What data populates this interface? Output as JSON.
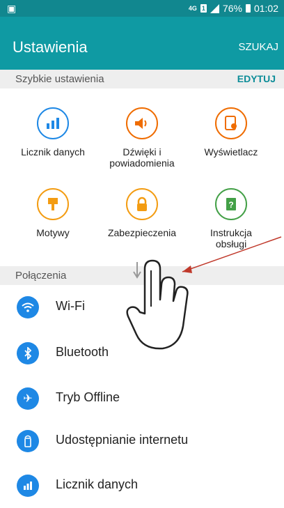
{
  "status_bar": {
    "network": "4G",
    "sim": "1",
    "battery": "76%",
    "time": "01:02"
  },
  "app_bar": {
    "title": "Ustawienia",
    "search_label": "SZUKAJ"
  },
  "quick_settings": {
    "header": "Szybkie ustawienia",
    "edit_label": "EDYTUJ",
    "items": [
      {
        "label": "Licznik danych",
        "icon": "data-usage-icon",
        "color": "#1e88e5"
      },
      {
        "label": "Dźwięki i powiadomienia",
        "icon": "volume-icon",
        "color": "#ef6c00"
      },
      {
        "label": "Wyświetlacz",
        "icon": "display-icon",
        "color": "#ef6c00"
      },
      {
        "label": "Motywy",
        "icon": "themes-brush-icon",
        "color": "#f39c12"
      },
      {
        "label": "Zabezpieczenia",
        "icon": "lock-icon",
        "color": "#f39c12"
      },
      {
        "label": "Instrukcja obsługi",
        "icon": "help-book-icon",
        "color": "#43a047"
      }
    ]
  },
  "connections": {
    "header": "Połączenia",
    "items": [
      {
        "label": "Wi-Fi",
        "icon": "wifi-icon"
      },
      {
        "label": "Bluetooth",
        "icon": "bluetooth-icon"
      },
      {
        "label": "Tryb Offline",
        "icon": "airplane-icon"
      },
      {
        "label": "Udostępnianie internetu",
        "icon": "hotspot-icon"
      },
      {
        "label": "Licznik danych",
        "icon": "data-usage-icon"
      }
    ]
  },
  "colors": {
    "status_bar": "#11878f",
    "app_bar": "#0f9aa3",
    "accent": "#0d8d98",
    "list_icon": "#1e88e5",
    "annotation_arrow": "#c0392b"
  }
}
